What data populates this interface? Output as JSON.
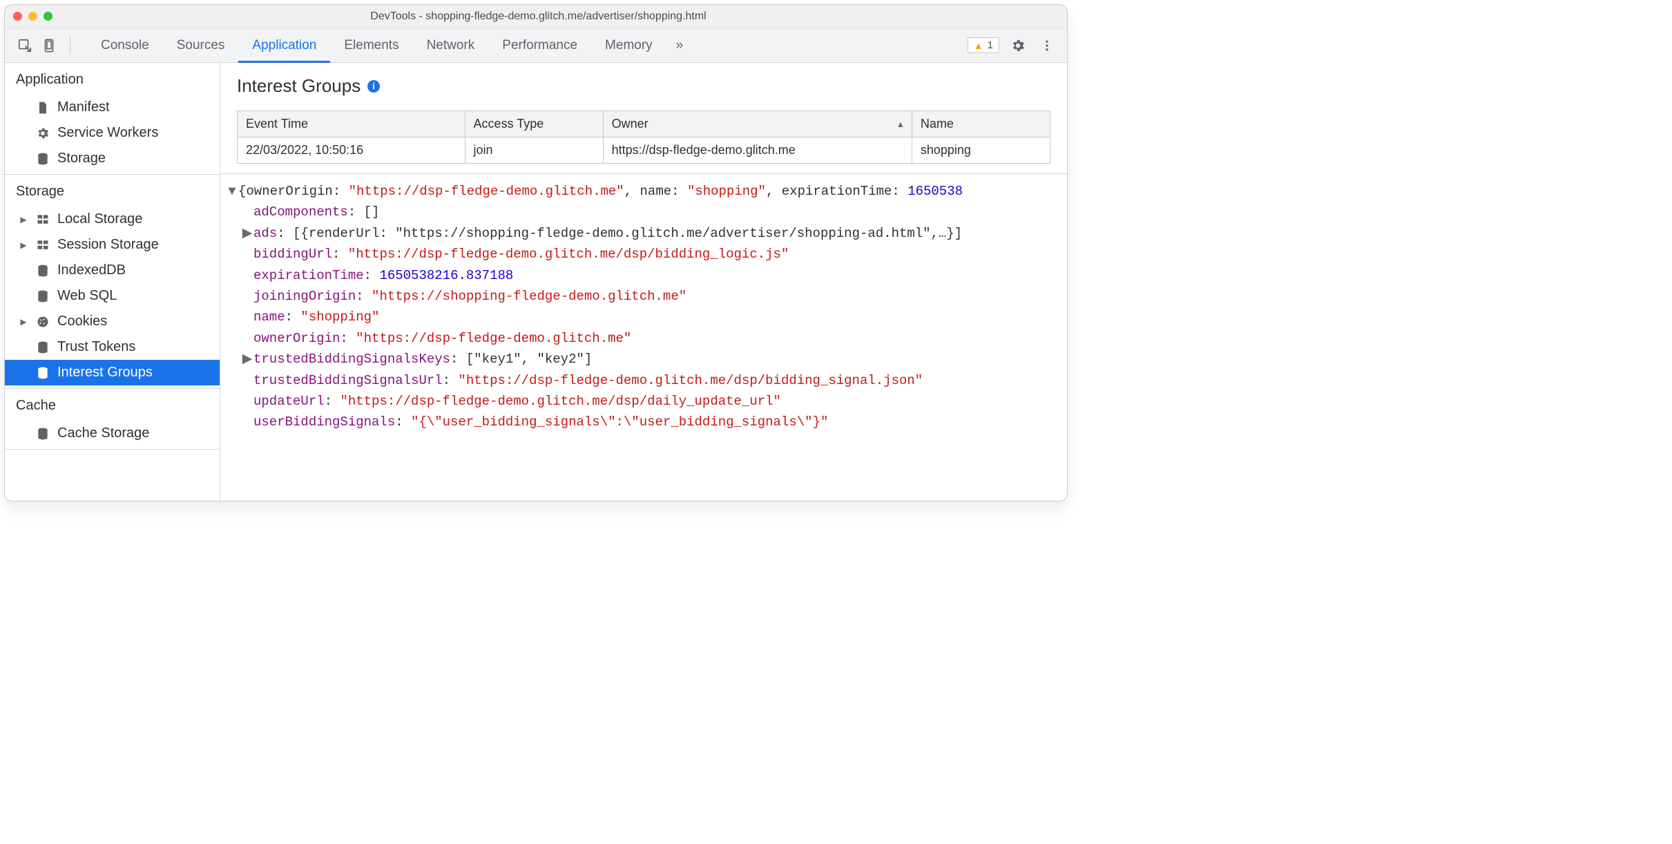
{
  "window_title": "DevTools - shopping-fledge-demo.glitch.me/advertiser/shopping.html",
  "toolbar": {
    "tabs": [
      "Console",
      "Sources",
      "Application",
      "Elements",
      "Network",
      "Performance",
      "Memory"
    ],
    "active_tab": "Application",
    "overflow_glyph": "»",
    "warn_count": "1"
  },
  "sidebar": {
    "sections": [
      {
        "title": "Application",
        "items": [
          {
            "label": "Manifest",
            "icon": "file",
            "caret": ""
          },
          {
            "label": "Service Workers",
            "icon": "gear",
            "caret": ""
          },
          {
            "label": "Storage",
            "icon": "db",
            "caret": ""
          }
        ]
      },
      {
        "title": "Storage",
        "items": [
          {
            "label": "Local Storage",
            "icon": "grid",
            "caret": "▶"
          },
          {
            "label": "Session Storage",
            "icon": "grid",
            "caret": "▶"
          },
          {
            "label": "IndexedDB",
            "icon": "db",
            "caret": ""
          },
          {
            "label": "Web SQL",
            "icon": "db",
            "caret": ""
          },
          {
            "label": "Cookies",
            "icon": "cookie",
            "caret": "▶"
          },
          {
            "label": "Trust Tokens",
            "icon": "db",
            "caret": ""
          },
          {
            "label": "Interest Groups",
            "icon": "db",
            "caret": "",
            "selected": true
          }
        ]
      },
      {
        "title": "Cache",
        "items": [
          {
            "label": "Cache Storage",
            "icon": "db",
            "caret": ""
          }
        ]
      }
    ]
  },
  "panel": {
    "title": "Interest Groups",
    "columns": [
      "Event Time",
      "Access Type",
      "Owner",
      "Name"
    ],
    "row": {
      "event_time": "22/03/2022, 10:50:16",
      "access_type": "join",
      "owner": "https://dsp-fledge-demo.glitch.me",
      "name": "shopping"
    }
  },
  "detail": {
    "summary_prefix": "{ownerOrigin: ",
    "summary_owner": "\"https://dsp-fledge-demo.glitch.me\"",
    "summary_mid1": ", name: ",
    "summary_name": "\"shopping\"",
    "summary_mid2": ", expirationTime: ",
    "summary_exp": "1650538",
    "adComponents_key": "adComponents",
    "adComponents_val": "[]",
    "ads_key": "ads",
    "ads_val": "[{renderUrl: \"https://shopping-fledge-demo.glitch.me/advertiser/shopping-ad.html\",…}]",
    "biddingUrl_key": "biddingUrl",
    "biddingUrl_val": "\"https://dsp-fledge-demo.glitch.me/dsp/bidding_logic.js\"",
    "expirationTime_key": "expirationTime",
    "expirationTime_val": "1650538216.837188",
    "joiningOrigin_key": "joiningOrigin",
    "joiningOrigin_val": "\"https://shopping-fledge-demo.glitch.me\"",
    "name_key": "name",
    "name_val": "\"shopping\"",
    "ownerOrigin_key": "ownerOrigin",
    "ownerOrigin_val": "\"https://dsp-fledge-demo.glitch.me\"",
    "tbsk_key": "trustedBiddingSignalsKeys",
    "tbsk_val": "[\"key1\", \"key2\"]",
    "tbsu_key": "trustedBiddingSignalsUrl",
    "tbsu_val": "\"https://dsp-fledge-demo.glitch.me/dsp/bidding_signal.json\"",
    "updateUrl_key": "updateUrl",
    "updateUrl_val": "\"https://dsp-fledge-demo.glitch.me/dsp/daily_update_url\"",
    "ubs_key": "userBiddingSignals",
    "ubs_val": "\"{\\\"user_bidding_signals\\\":\\\"user_bidding_signals\\\"}\""
  }
}
